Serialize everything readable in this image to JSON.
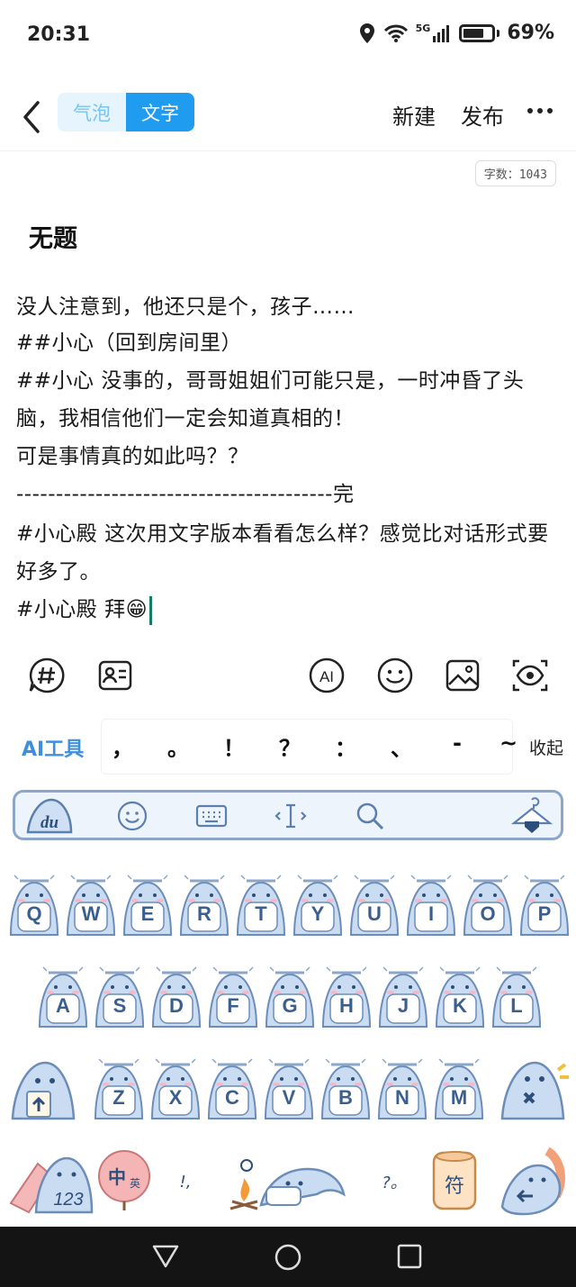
{
  "status": {
    "time": "20:31",
    "network": "5G",
    "battery": "69%"
  },
  "topbar": {
    "tab_bubble": "气泡",
    "tab_text": "文字",
    "new_label": "新建",
    "publish_label": "发布"
  },
  "doc": {
    "word_count": "字数：1043",
    "title": "无题",
    "paragraphs": [
      "  没人注意到，他还只是个，孩子……",
      "  ##小心（回到房间里）",
      "  ##小心 没事的，哥哥姐姐们可能只是，一时冲昏了头脑，我相信他们一定会知道真相的！",
      "  可是事情真的如此吗？？",
      "  ----------------------------------------完",
      "  #小心殿 这次用文字版本看看怎么样？感觉比对话形式要好多了。",
      "  #小心殿 拜😁"
    ]
  },
  "tools": [
    "hashtag-bubble-icon",
    "contact-card-icon",
    "ai-icon",
    "emoji-icon",
    "image-icon",
    "preview-eye-icon"
  ],
  "punct_row": {
    "ai_tools": "AI工具",
    "marks": [
      "，",
      "。",
      "！",
      "？",
      "：",
      "、",
      "-",
      "~"
    ],
    "collapse": "收起"
  },
  "keyboard": {
    "row1": [
      "Q",
      "W",
      "E",
      "R",
      "T",
      "Y",
      "U",
      "I",
      "O",
      "P"
    ],
    "row2": [
      "A",
      "S",
      "D",
      "F",
      "G",
      "H",
      "J",
      "K",
      "L"
    ],
    "row3": [
      "Z",
      "X",
      "C",
      "V",
      "B",
      "N",
      "M"
    ],
    "logo": "du",
    "num_key": "123",
    "lang_key_main": "中",
    "lang_key_sub": "英",
    "comma_key": "!,",
    "period_key": "?。",
    "symbol_key": "符",
    "colors": {
      "shark": "#c9dcf2",
      "shark_outline": "#6c8db8",
      "label": "#3a5f8f"
    }
  }
}
